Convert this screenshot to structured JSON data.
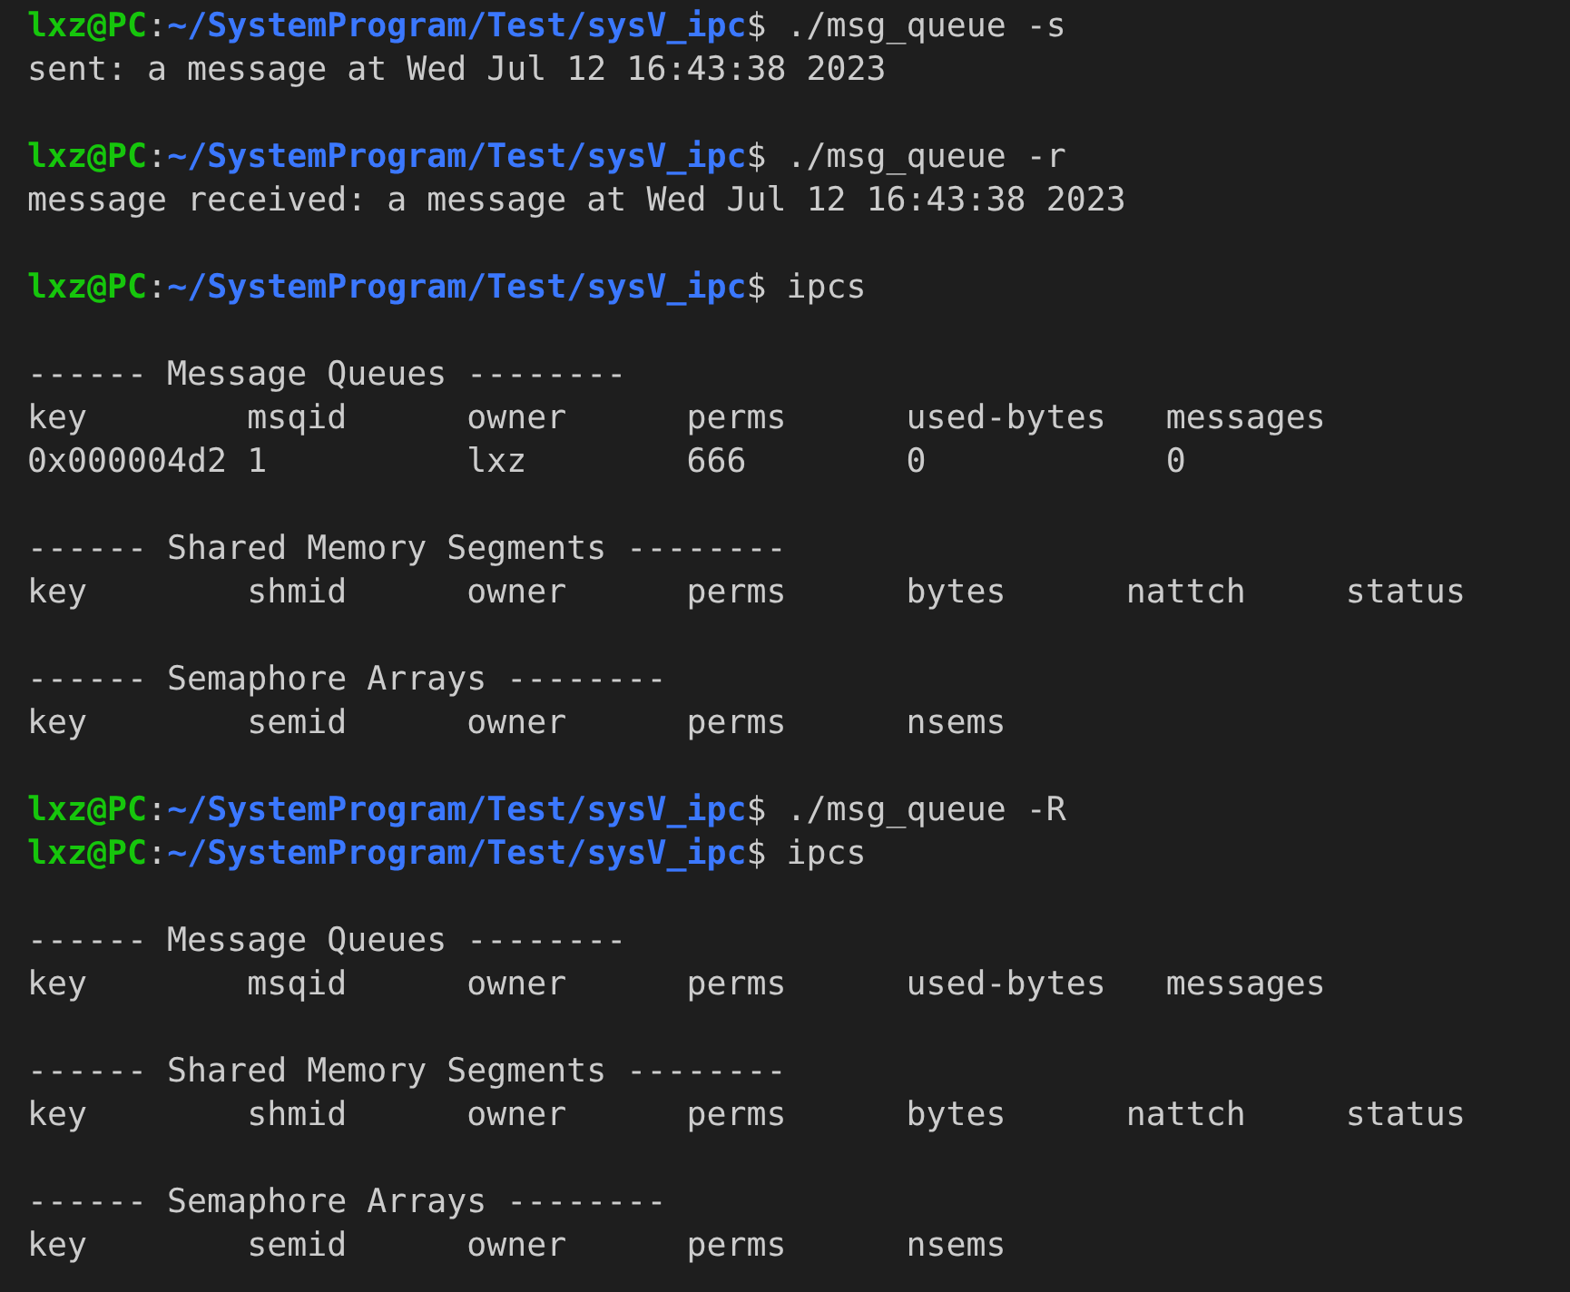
{
  "terminal": {
    "lines": [
      {
        "kind": "prompt",
        "user": "lxz@PC",
        "sep": ":",
        "path": "~/SystemProgram/Test/sysV_ipc",
        "symbol": "$",
        "command": "./msg_queue -s"
      },
      {
        "kind": "output",
        "text": "sent: a message at Wed Jul 12 16:43:38 2023"
      },
      {
        "kind": "blank"
      },
      {
        "kind": "prompt",
        "user": "lxz@PC",
        "sep": ":",
        "path": "~/SystemProgram/Test/sysV_ipc",
        "symbol": "$",
        "command": "./msg_queue -r"
      },
      {
        "kind": "output",
        "text": "message received: a message at Wed Jul 12 16:43:38 2023"
      },
      {
        "kind": "blank"
      },
      {
        "kind": "prompt",
        "user": "lxz@PC",
        "sep": ":",
        "path": "~/SystemProgram/Test/sysV_ipc",
        "symbol": "$",
        "command": "ipcs"
      },
      {
        "kind": "blank"
      },
      {
        "kind": "output",
        "text": "------ Message Queues --------"
      },
      {
        "kind": "output",
        "text": "key        msqid      owner      perms      used-bytes   messages"
      },
      {
        "kind": "output",
        "text": "0x000004d2 1          lxz        666        0            0"
      },
      {
        "kind": "blank"
      },
      {
        "kind": "output",
        "text": "------ Shared Memory Segments --------"
      },
      {
        "kind": "output",
        "text": "key        shmid      owner      perms      bytes      nattch     status"
      },
      {
        "kind": "blank"
      },
      {
        "kind": "output",
        "text": "------ Semaphore Arrays --------"
      },
      {
        "kind": "output",
        "text": "key        semid      owner      perms      nsems"
      },
      {
        "kind": "blank"
      },
      {
        "kind": "prompt",
        "user": "lxz@PC",
        "sep": ":",
        "path": "~/SystemProgram/Test/sysV_ipc",
        "symbol": "$",
        "command": "./msg_queue -R"
      },
      {
        "kind": "prompt",
        "user": "lxz@PC",
        "sep": ":",
        "path": "~/SystemProgram/Test/sysV_ipc",
        "symbol": "$",
        "command": "ipcs"
      },
      {
        "kind": "blank"
      },
      {
        "kind": "output",
        "text": "------ Message Queues --------"
      },
      {
        "kind": "output",
        "text": "key        msqid      owner      perms      used-bytes   messages"
      },
      {
        "kind": "blank"
      },
      {
        "kind": "output",
        "text": "------ Shared Memory Segments --------"
      },
      {
        "kind": "output",
        "text": "key        shmid      owner      perms      bytes      nattch     status"
      },
      {
        "kind": "blank"
      },
      {
        "kind": "output",
        "text": "------ Semaphore Arrays --------"
      },
      {
        "kind": "output",
        "text": "key        semid      owner      perms      nsems"
      }
    ]
  }
}
